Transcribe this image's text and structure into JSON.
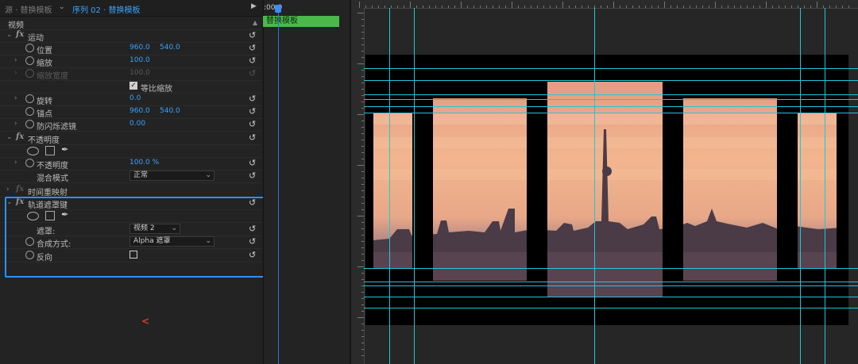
{
  "header": {
    "source_crumb": "源 · 替换模板",
    "sequence_crumb": "序列 02 · 替换模板",
    "clip_label": "替换模板",
    "timecode": ":00:0"
  },
  "section": {
    "video_label": "视频"
  },
  "motion": {
    "title": "运动",
    "position": {
      "label": "位置",
      "x": "960.0",
      "y": "540.0"
    },
    "scale": {
      "label": "缩放",
      "value": "100.0"
    },
    "scale_width": {
      "label": "缩放宽度",
      "value": "100.0"
    },
    "uniform_scale": {
      "label": "等比缩放",
      "checked": true
    },
    "rotation": {
      "label": "旋转",
      "value": "0.0"
    },
    "anchor": {
      "label": "锚点",
      "x": "960.0",
      "y": "540.0"
    },
    "anti_flicker": {
      "label": "防闪烁滤镜",
      "value": "0.00"
    }
  },
  "opacity": {
    "title": "不透明度",
    "opacity": {
      "label": "不透明度",
      "value": "100.0 %"
    },
    "blend_mode": {
      "label": "混合模式",
      "value": "正常"
    }
  },
  "time_remap": {
    "title": "时间重映射"
  },
  "track_matte": {
    "title": "轨道遮罩键",
    "matte": {
      "label": "遮罩:",
      "value": "视频 2"
    },
    "composite": {
      "label": "合成方式:",
      "value": "Alpha 遮罩"
    },
    "reverse": {
      "label": "反向",
      "checked": false
    }
  },
  "colors": {
    "accent_blue": "#2e90ff",
    "value_blue": "#3aa3ff",
    "clip_green": "#4bb84a",
    "guide_cyan": "#21c6d6"
  },
  "monitor": {
    "content": "Berlin skyline at sunset with TV tower, shown through five vertical panel masks"
  }
}
